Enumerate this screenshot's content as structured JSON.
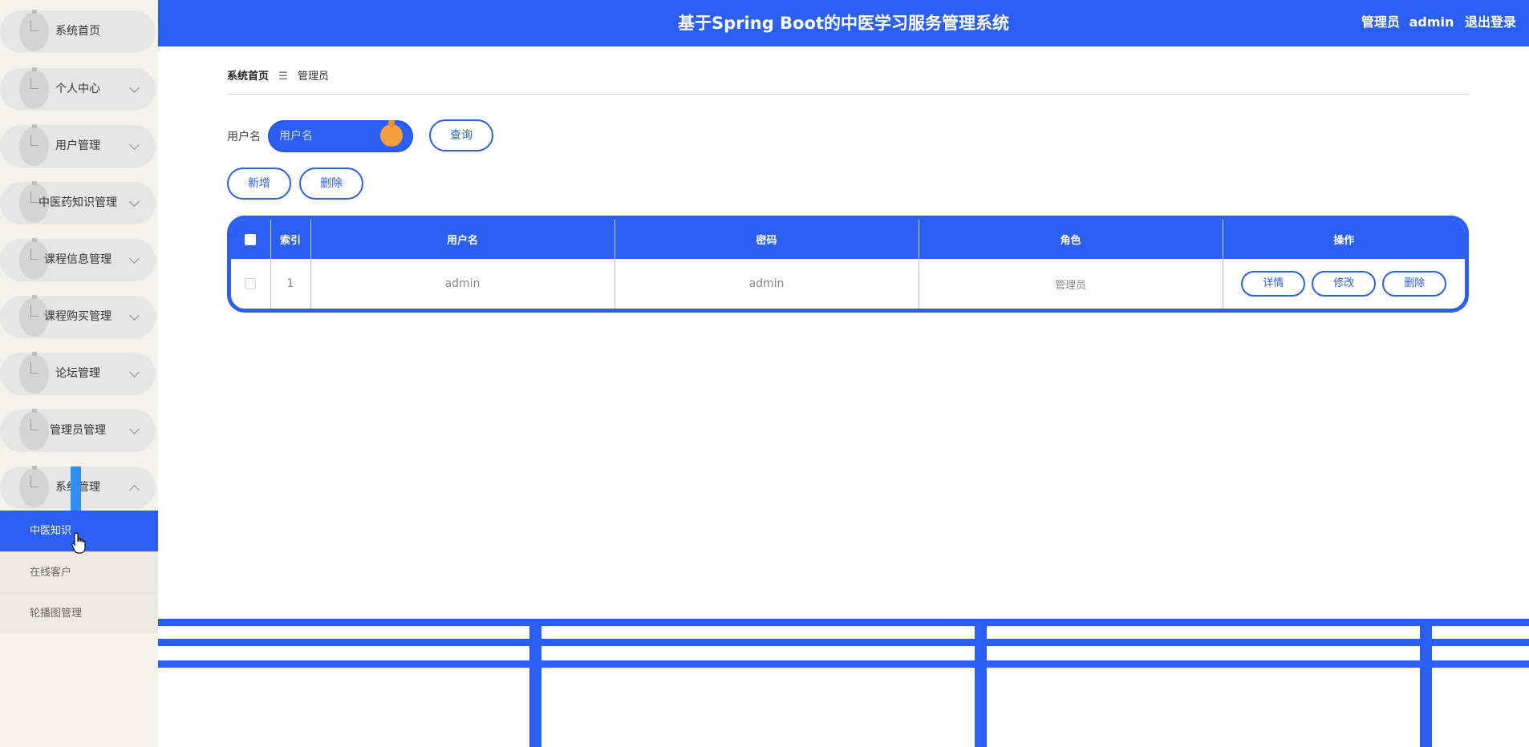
{
  "app": {
    "title": "基于Spring Boot的中医学习服务管理系统",
    "user_role": "管理员",
    "username": "admin",
    "logout_label": "退出登录"
  },
  "sidebar": {
    "items": [
      {
        "label": "系统首页",
        "has_children": false
      },
      {
        "label": "个人中心",
        "has_children": true
      },
      {
        "label": "用户管理",
        "has_children": true
      },
      {
        "label": "中医药知识管理",
        "has_children": true
      },
      {
        "label": "课程信息管理",
        "has_children": true
      },
      {
        "label": "课程购买管理",
        "has_children": true
      },
      {
        "label": "论坛管理",
        "has_children": true
      },
      {
        "label": "管理员管理",
        "has_children": true
      },
      {
        "label": "系统管理",
        "has_children": true,
        "expanded": true
      }
    ],
    "submenu": [
      {
        "label": "中医知识",
        "active": true
      },
      {
        "label": "在线客户",
        "active": false
      },
      {
        "label": "轮播图管理",
        "active": false
      }
    ]
  },
  "breadcrumb": {
    "home": "系统首页",
    "separator": "☰",
    "current": "管理员"
  },
  "search": {
    "label": "用户名",
    "placeholder": "用户名",
    "value": "",
    "query_button": "查询"
  },
  "actions": {
    "add": "新增",
    "delete": "删除"
  },
  "table": {
    "columns": [
      "索引",
      "用户名",
      "密码",
      "角色",
      "操作"
    ],
    "rows": [
      {
        "index": "1",
        "username": "admin",
        "password": "admin",
        "role": "管理员"
      }
    ],
    "row_actions": {
      "detail": "详情",
      "edit": "修改",
      "delete": "删除"
    }
  },
  "colors": {
    "primary": "#2b5ff2",
    "sidebar_bg": "#f4f2ec",
    "menu_pill": "#e6e6e6",
    "knob": "#f5a03c"
  },
  "icons": {
    "menu": "menu-bullet-icon",
    "chevron": "chevron-down-icon",
    "breadcrumb_separator": "menu-icon",
    "cursor": "hand-cursor-icon"
  }
}
